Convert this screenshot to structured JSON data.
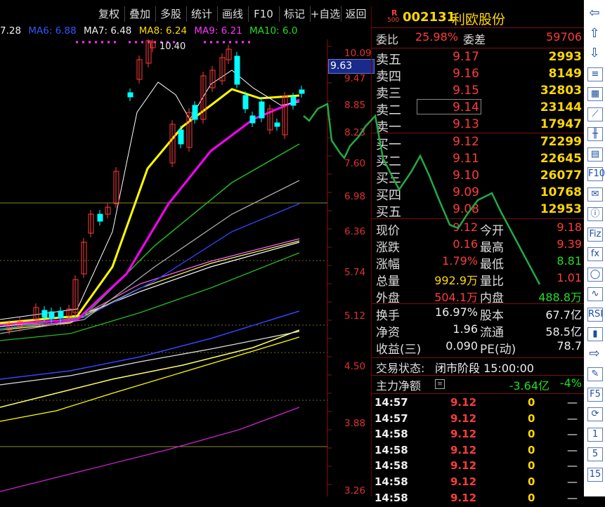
{
  "toolbar": {
    "buttons": [
      "复权",
      "叠加",
      "多股",
      "统计",
      "画线",
      "F10",
      "标记",
      "+自选",
      "返回"
    ]
  },
  "indicators": {
    "ma_lead": "7.28",
    "ma6": "MA6: 6.88",
    "ma7": "MA7: 6.48",
    "ma8": "MA8: 6.24",
    "ma9": "MA9: 6.21",
    "ma10": "MA10: 6.0"
  },
  "chart": {
    "y_ticks": [
      "10.09",
      "9.47",
      "8.85",
      "8.23",
      "7.60",
      "6.98",
      "6.36",
      "5.74",
      "5.12",
      "4.50",
      "3.88",
      "3.26"
    ],
    "current_price_tag": "9.63",
    "high_label": "10.40",
    "colors": {
      "ma_white": "#ffffff",
      "ma_yellow": "#ffff00",
      "ma_magenta": "#ff00ff",
      "up": "#ff3b3b",
      "down": "#00ffff",
      "forecast": "#22aa44"
    }
  },
  "quote": {
    "r_badge": "R",
    "r_sub": "500",
    "code": "002131",
    "name": "利欧股份",
    "weibi_label": "委比",
    "weibi_value": "25.98%",
    "weicha_label": "委差",
    "weicha_value": "59706",
    "asks": [
      {
        "label": "卖五",
        "price": "9.17",
        "vol": "2993"
      },
      {
        "label": "卖四",
        "price": "9.16",
        "vol": "8149"
      },
      {
        "label": "卖三",
        "price": "9.15",
        "vol": "32803"
      },
      {
        "label": "卖二",
        "price": "9.14",
        "vol": "23144"
      },
      {
        "label": "卖一",
        "price": "9.13",
        "vol": "17947"
      }
    ],
    "bids": [
      {
        "label": "买一",
        "price": "9.12",
        "vol": "72299"
      },
      {
        "label": "买二",
        "price": "9.11",
        "vol": "22645"
      },
      {
        "label": "买三",
        "price": "9.10",
        "vol": "26077"
      },
      {
        "label": "买四",
        "price": "9.09",
        "vol": "10768"
      },
      {
        "label": "买五",
        "price": "9.08",
        "vol": "12953"
      }
    ],
    "stats": [
      {
        "l1": "现价",
        "v1": "9.12",
        "l2": "今开",
        "v2": "9.18"
      },
      {
        "l1": "涨跌",
        "v1": "0.16",
        "l2": "最高",
        "v2": "9.39"
      },
      {
        "l1": "涨幅",
        "v1": "1.79%",
        "l2": "最低",
        "v2": "8.81"
      },
      {
        "l1": "总量",
        "v1": "992.9万",
        "l2": "量比",
        "v2": "1.01"
      },
      {
        "l1": "外盘",
        "v1": "504.1万",
        "l2": "内盘",
        "v2": "488.8万"
      }
    ],
    "fund": [
      {
        "l1": "换手",
        "v1": "16.97%",
        "l2": "股本",
        "v2": "67.7亿"
      },
      {
        "l1": "净资",
        "v1": "1.96",
        "l2": "流通",
        "v2": "58.5亿"
      },
      {
        "l1": "收益(三)",
        "v1": "0.090",
        "l2": "PE(动)",
        "v2": "78.7"
      }
    ],
    "status_label": "交易状态:",
    "status_value": "闭市阶段 15:00:00",
    "flow_label": "主力净额",
    "flow_value": "-3.64亿",
    "flow_pct": "-4%",
    "ticks": [
      {
        "time": "14:57",
        "price": "9.12",
        "vol": "0",
        "flag": "—"
      },
      {
        "time": "14:57",
        "price": "9.12",
        "vol": "0",
        "flag": "—"
      },
      {
        "time": "14:58",
        "price": "9.12",
        "vol": "0",
        "flag": "—"
      },
      {
        "time": "14:58",
        "price": "9.12",
        "vol": "0",
        "flag": "—"
      },
      {
        "time": "14:58",
        "price": "9.12",
        "vol": "0",
        "flag": "—"
      },
      {
        "time": "14:58",
        "price": "9.12",
        "vol": "0",
        "flag": "—"
      },
      {
        "time": "14:58",
        "price": "9.12",
        "vol": "0",
        "flag": "—"
      }
    ]
  },
  "sidebar": {
    "icons": [
      "arrow-left-icon",
      "arrow-up-icon",
      "arrow-down-icon",
      "list-icon",
      "grid-icon",
      "line-chart-icon",
      "candle-icon",
      "window-icon",
      "f10-icon",
      "news-icon",
      "info-icon",
      "fz-icon",
      "fx-icon",
      "circle-icon",
      "wave-icon",
      "rsi-icon",
      "bars-icon",
      "arrow-right-icon",
      "pen-icon",
      "f5-icon",
      "refresh-icon",
      "page-1-icon",
      "page-5-icon",
      "page-15-icon"
    ],
    "labels": [
      "⇦",
      "⇧",
      "⇩",
      "≡",
      "▦",
      "⟋",
      "╫",
      "▤",
      "F10",
      "✉",
      "ⓘ",
      "Fiz",
      "fx",
      "◯",
      "∿",
      "RSI",
      "▮",
      "⇨",
      "✎",
      "F5",
      "⟳",
      "1",
      "5",
      "15"
    ]
  }
}
